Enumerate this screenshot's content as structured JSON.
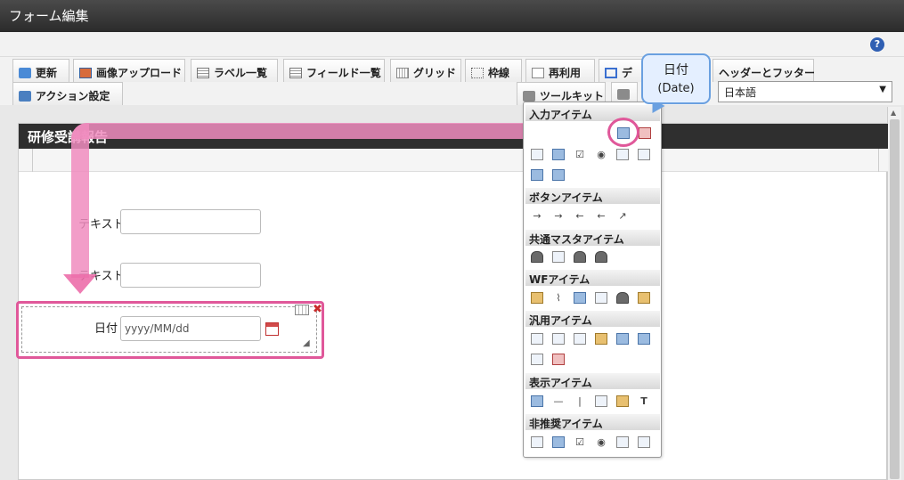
{
  "window": {
    "title": "フォーム編集"
  },
  "toolbar": {
    "update": "更新",
    "image_upload": "画像アップロード",
    "label_list": "ラベル一覧",
    "field_list": "フィールド一覧",
    "grid": "グリッド",
    "frame": "枠線",
    "reuse": "再利用",
    "design": "デ",
    "header_footer": "ヘッダーとフッター",
    "action_settings": "アクション設定",
    "toolkit": "ツールキット",
    "language": "日本語"
  },
  "form": {
    "title": "研修受講報告",
    "field1_label": "テキスト",
    "field2_label": "テキスト",
    "date_label": "日付",
    "date_placeholder": "yyyy/MM/dd"
  },
  "palette": {
    "sections": [
      "入力アイテム",
      "ボタンアイテム",
      "共通マスタアイテム",
      "WFアイテム",
      "汎用アイテム",
      "表示アイテム",
      "非推奨アイテム"
    ]
  },
  "callout": {
    "line1": "日付",
    "line2": "(Date)"
  },
  "colors": {
    "highlight": "#e0589a",
    "arrow": "#f08cbe",
    "callout_border": "#6aa0e0"
  }
}
